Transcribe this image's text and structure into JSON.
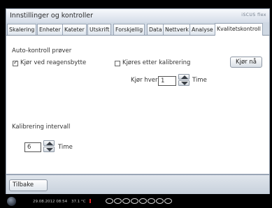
{
  "window": {
    "title": "Innstillinger og kontroller",
    "brand": "iSCUS flex"
  },
  "tabs": [
    {
      "label": "Skalering",
      "active": false
    },
    {
      "label": "Enheter",
      "active": false
    },
    {
      "label": "Kateter",
      "active": false
    },
    {
      "label": "Utskrift",
      "active": false
    },
    {
      "label": "Forskjellig",
      "active": false
    },
    {
      "label": "Data",
      "active": false
    },
    {
      "label": "Nettverk",
      "active": false
    },
    {
      "label": "Analyse",
      "active": false
    },
    {
      "label": "Kvalitetskontroll",
      "active": true
    }
  ],
  "auto_control": {
    "heading": "Auto-kontroll prøver",
    "reagent_change": {
      "label": "Kjør ved reagensbytte",
      "checked": true
    },
    "after_calibration": {
      "label": "Kjøres etter kalibrering",
      "checked": false
    },
    "run_now_label": "Kjør nå",
    "run_every_label": "Kjør hver",
    "run_every_value": "1",
    "run_every_unit": "Time"
  },
  "calibration": {
    "heading": "Kalibrering intervall",
    "value": "6",
    "unit": "Time"
  },
  "footer": {
    "back_label": "Tilbake"
  },
  "statusbar": {
    "datetime": "29.08.2012 08:54",
    "temperature": "37.1 °C"
  },
  "icons": {
    "spin_up": "triangle-up-icon",
    "spin_down": "triangle-down-icon",
    "power": "power-button-icon"
  }
}
